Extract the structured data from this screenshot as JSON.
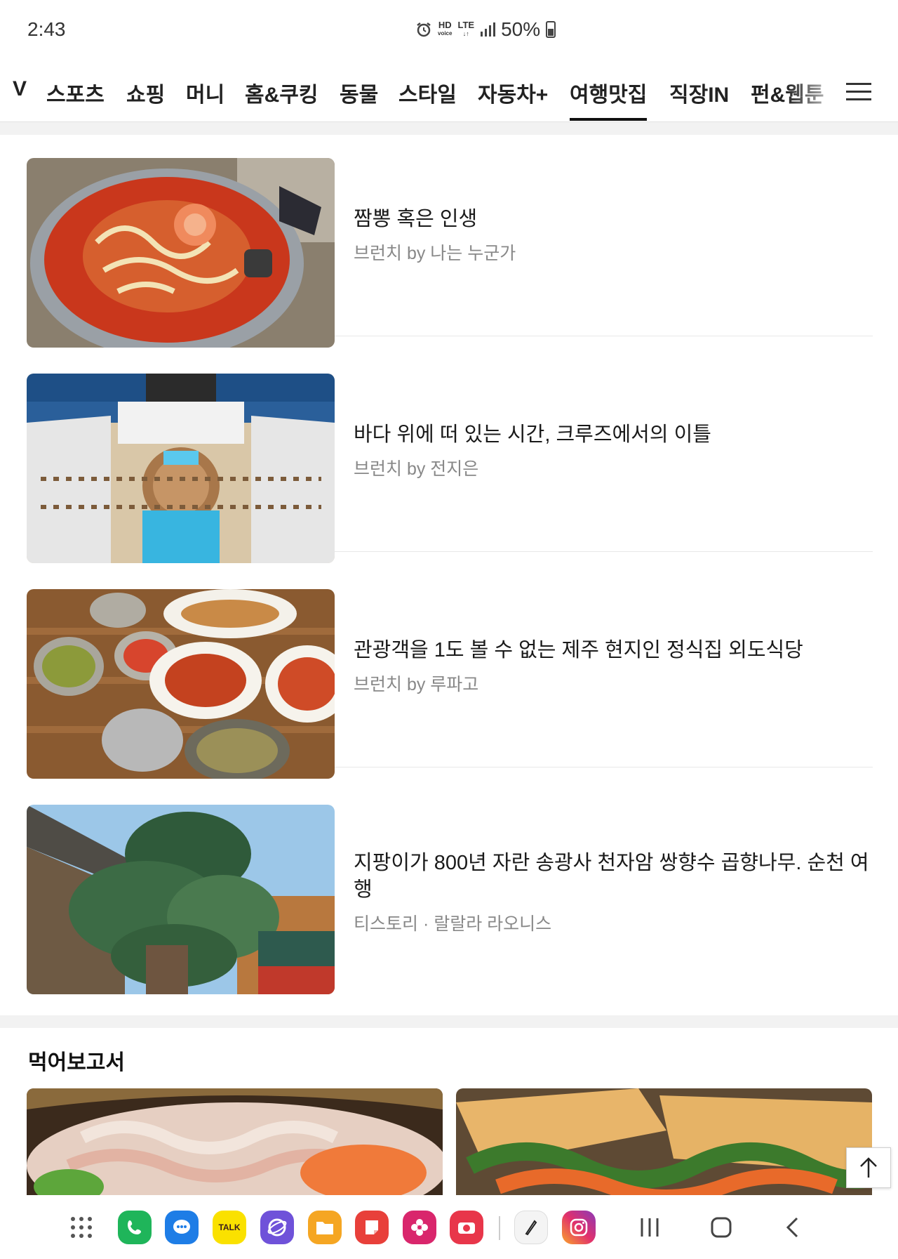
{
  "status": {
    "time": "2:43",
    "hd_top": "HD",
    "hd_bottom": "voice",
    "lte": "LTE",
    "battery": "50%"
  },
  "categories": [
    {
      "label": "V"
    },
    {
      "label": "스포츠"
    },
    {
      "label": "쇼핑"
    },
    {
      "label": "머니"
    },
    {
      "label": "홈&쿠킹"
    },
    {
      "label": "동물"
    },
    {
      "label": "스타일"
    },
    {
      "label": "자동차+"
    },
    {
      "label": "여행맛집",
      "active": true
    },
    {
      "label": "직장IN"
    },
    {
      "label": "펀&웹툰"
    }
  ],
  "articles": [
    {
      "title": "짬뽕 혹은 인생",
      "meta": "브런치 by 나는 누군가"
    },
    {
      "title": "바다 위에 떠 있는 시간, 크루즈에서의 이틀",
      "meta": "브런치 by 전지은"
    },
    {
      "title": "관광객을 1도 볼 수 없는 제주 현지인 정식집 외도식당",
      "meta": "브런치 by 루파고"
    },
    {
      "title": "지팡이가 800년 자란 송광사 천자암 쌍향수 곱향나무. 순천 여행",
      "meta": "티스토리 · 랄랄라 라오니스"
    }
  ],
  "food_section": {
    "title": "먹어보고서"
  },
  "nav": {
    "kakaotalk_label": "TALK"
  },
  "colors": {
    "active_underline": "#111111",
    "meta_text": "#888888",
    "divider": "#e8e8e8"
  }
}
